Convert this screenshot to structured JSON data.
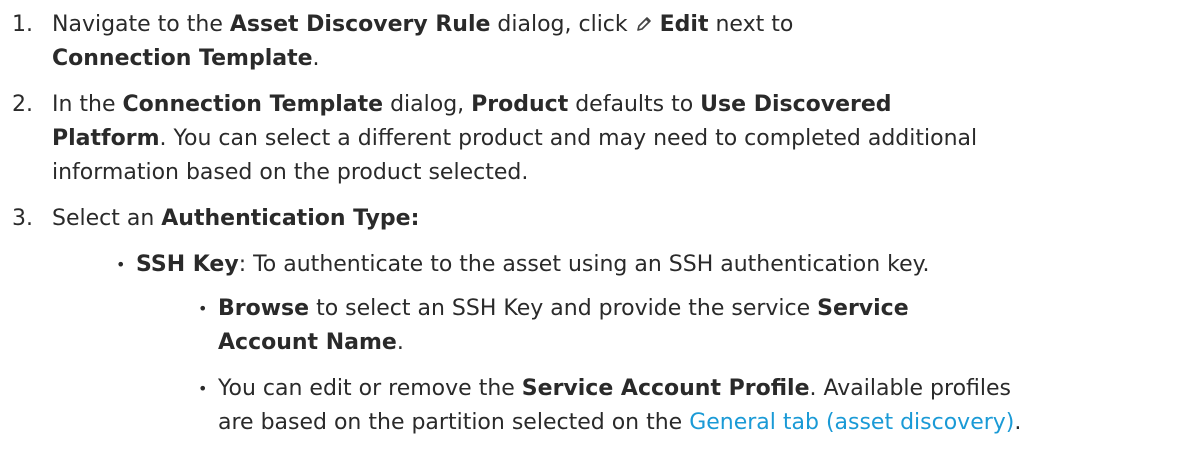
{
  "steps": [
    {
      "num": "1.",
      "line1": {
        "t1": "Navigate to the ",
        "b1": "Asset Discovery Rule",
        "t2": " dialog, click ",
        "b2": "Edit",
        "t3": " next to"
      },
      "line2": {
        "b1": "Connection Template",
        "t1": "."
      }
    },
    {
      "num": "2.",
      "line1": {
        "t1": "In the ",
        "b1": "Connection Template",
        "t2": " dialog, ",
        "b2": "Product",
        "t3": " defaults to ",
        "b3": "Use Discovered"
      },
      "line2": {
        "b1": "Platform",
        "t1": ". You can select a different product and may need to completed additional"
      },
      "line3": "information based on the product selected."
    },
    {
      "num": "3.",
      "line1": {
        "t1": "Select an ",
        "b1": "Authentication Type:"
      }
    }
  ],
  "bullets": {
    "ssh_key": {
      "b1": "SSH Key",
      "t1": ": To authenticate to the asset using an SSH authentication key."
    },
    "browse": {
      "line1": {
        "b1": "Browse",
        "t1": " to select an SSH Key and provide the service ",
        "b2": "Service"
      },
      "line2": {
        "b1": "Account Name",
        "t1": "."
      }
    },
    "profile": {
      "line1": {
        "t1": "You can edit or remove the ",
        "b1": "Service Account Profile",
        "t2": ". Available profiles"
      },
      "line2": {
        "t1": "are based on the partition selected on the ",
        "link": "General tab (asset discovery)",
        "t2": "."
      }
    }
  },
  "icons": {
    "edit": "pencil-icon"
  },
  "colors": {
    "text": "#2a2a2a",
    "link": "#1a9ad6"
  }
}
